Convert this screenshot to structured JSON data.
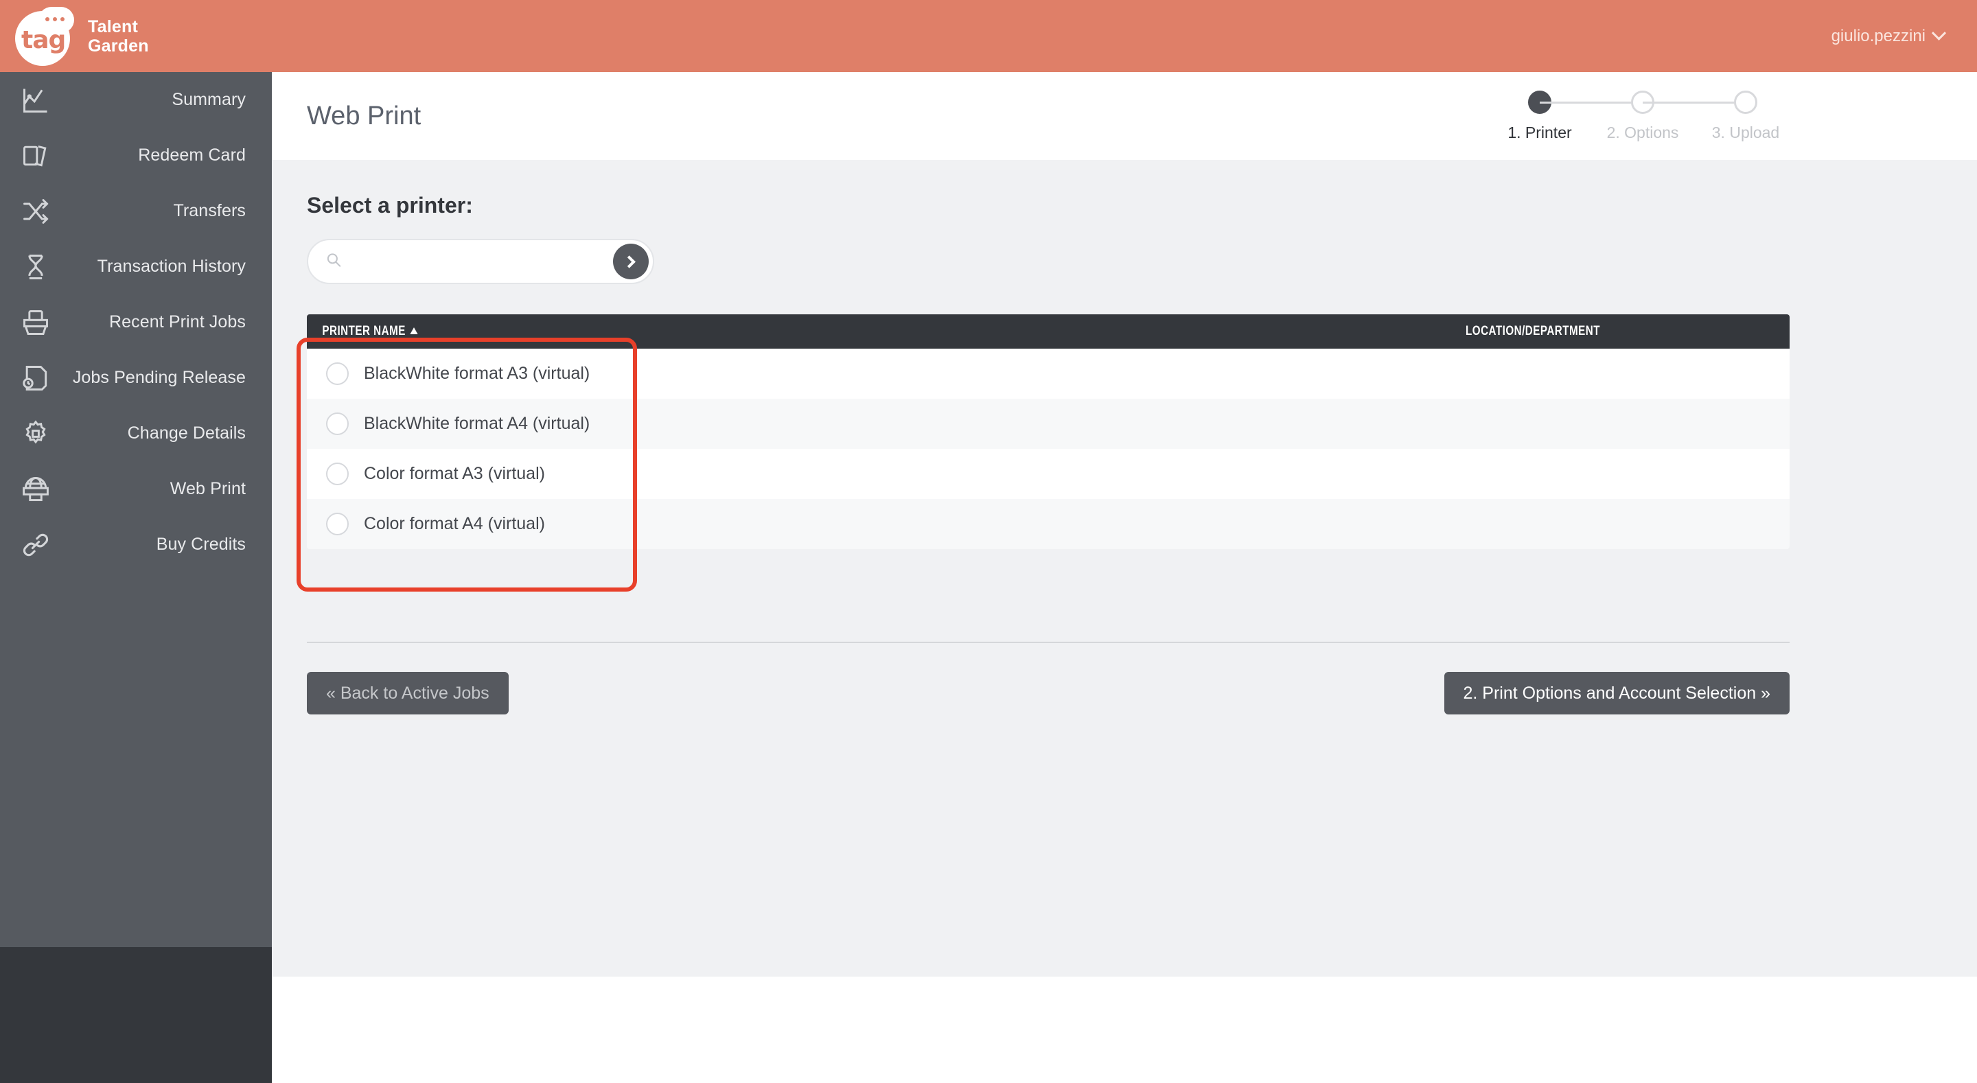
{
  "brand": {
    "mark_text": "tag",
    "name_line1": "Talent",
    "name_line2": "Garden",
    "logo_icon": "tag-speech-bubble-logo"
  },
  "header": {
    "username": "giulio.pezzini",
    "chevron_icon": "chevron-down-icon",
    "background_color": "#df7f68"
  },
  "sidebar": {
    "background_color": "#565a60",
    "footer_color": "#34373c",
    "items": [
      {
        "label": "Summary",
        "icon": "chart-line-icon"
      },
      {
        "label": "Redeem Card",
        "icon": "cards-icon"
      },
      {
        "label": "Transfers",
        "icon": "shuffle-arrows-icon"
      },
      {
        "label": "Transaction History",
        "icon": "hourglass-icon"
      },
      {
        "label": "Recent Print Jobs",
        "icon": "printer-tray-icon"
      },
      {
        "label": "Jobs Pending Release",
        "icon": "document-clock-icon"
      },
      {
        "label": "Change Details",
        "icon": "gear-icon"
      },
      {
        "label": "Web Print",
        "icon": "web-printer-icon"
      },
      {
        "label": "Buy Credits",
        "icon": "link-chain-icon"
      }
    ]
  },
  "page": {
    "title": "Web Print",
    "stepper": [
      {
        "label": "1. Printer",
        "active": true
      },
      {
        "label": "2. Options",
        "active": false
      },
      {
        "label": "3. Upload",
        "active": false
      }
    ]
  },
  "content": {
    "section_title": "Select a printer:",
    "search": {
      "value": "",
      "placeholder": "",
      "search_icon": "search-icon",
      "submit_icon": "chevron-right-icon"
    },
    "table": {
      "columns": [
        {
          "label": "PRINTER NAME",
          "sort": "asc"
        },
        {
          "label": "LOCATION/DEPARTMENT",
          "sort": "none"
        }
      ],
      "rows": [
        {
          "name": "BlackWhite format A3 (virtual)",
          "location": "",
          "selected": false
        },
        {
          "name": "BlackWhite format A4 (virtual)",
          "location": "",
          "selected": false
        },
        {
          "name": "Color format A3 (virtual)",
          "location": "",
          "selected": false
        },
        {
          "name": "Color format A4 (virtual)",
          "location": "",
          "selected": false
        }
      ]
    },
    "buttons": {
      "back": "« Back to Active Jobs",
      "next": "2. Print Options and Account Selection »"
    }
  },
  "annotation": {
    "color": "#e8402a",
    "target": "printer-name-column-rows"
  }
}
